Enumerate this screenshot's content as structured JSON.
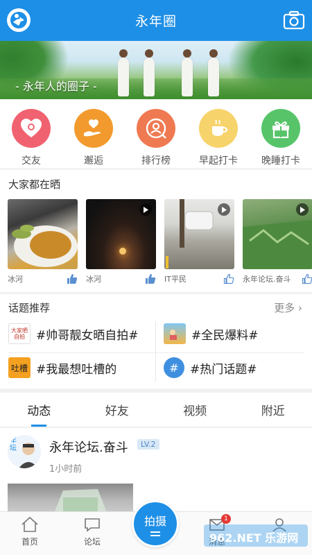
{
  "header": {
    "title": "永年圈",
    "logo_icon": "app-logo-icon",
    "camera_icon": "camera-icon"
  },
  "banner": {
    "caption": "- 永年人的圈子 -"
  },
  "quick_menu": [
    {
      "label": "交友",
      "icon": "heart-camera-icon",
      "color": "#f06270"
    },
    {
      "label": "邂逅",
      "icon": "hand-heart-icon",
      "color": "#f39a2e"
    },
    {
      "label": "排行榜",
      "icon": "rank-search-icon",
      "color": "#ef7a52"
    },
    {
      "label": "早起打卡",
      "icon": "coffee-cup-icon",
      "color": "#f7d36b"
    },
    {
      "label": "晚睡打卡",
      "icon": "gift-box-icon",
      "color": "#57c46a"
    }
  ],
  "share": {
    "title": "大家都在晒",
    "items": [
      {
        "author": "冰河",
        "video": false
      },
      {
        "author": "冰河",
        "video": true
      },
      {
        "author": "IT平民",
        "video": true
      },
      {
        "author": "永年论坛.奋斗",
        "video": true
      }
    ]
  },
  "topics": {
    "title": "话题推荐",
    "more": "更多",
    "items": [
      {
        "label": "#帅哥靓女晒自拍#",
        "icon_text": "大家晒自拍"
      },
      {
        "label": "#全民爆料#",
        "icon_text": ""
      },
      {
        "label": "#我最想吐槽的",
        "icon_text": "吐槽"
      },
      {
        "label": "#热门话题#",
        "icon_text": "#"
      }
    ]
  },
  "tabs": [
    "动态",
    "好友",
    "视频",
    "附近"
  ],
  "post": {
    "name": "永年论坛.奋斗",
    "level": "LV.2",
    "time": "1小时前",
    "avatar_text": "年坛"
  },
  "bottom_nav": {
    "home": "首页",
    "forum": "论坛",
    "shoot": "拍摄",
    "messages": "消息",
    "badge": "1",
    "watermark": "962.NET 乐游网"
  }
}
